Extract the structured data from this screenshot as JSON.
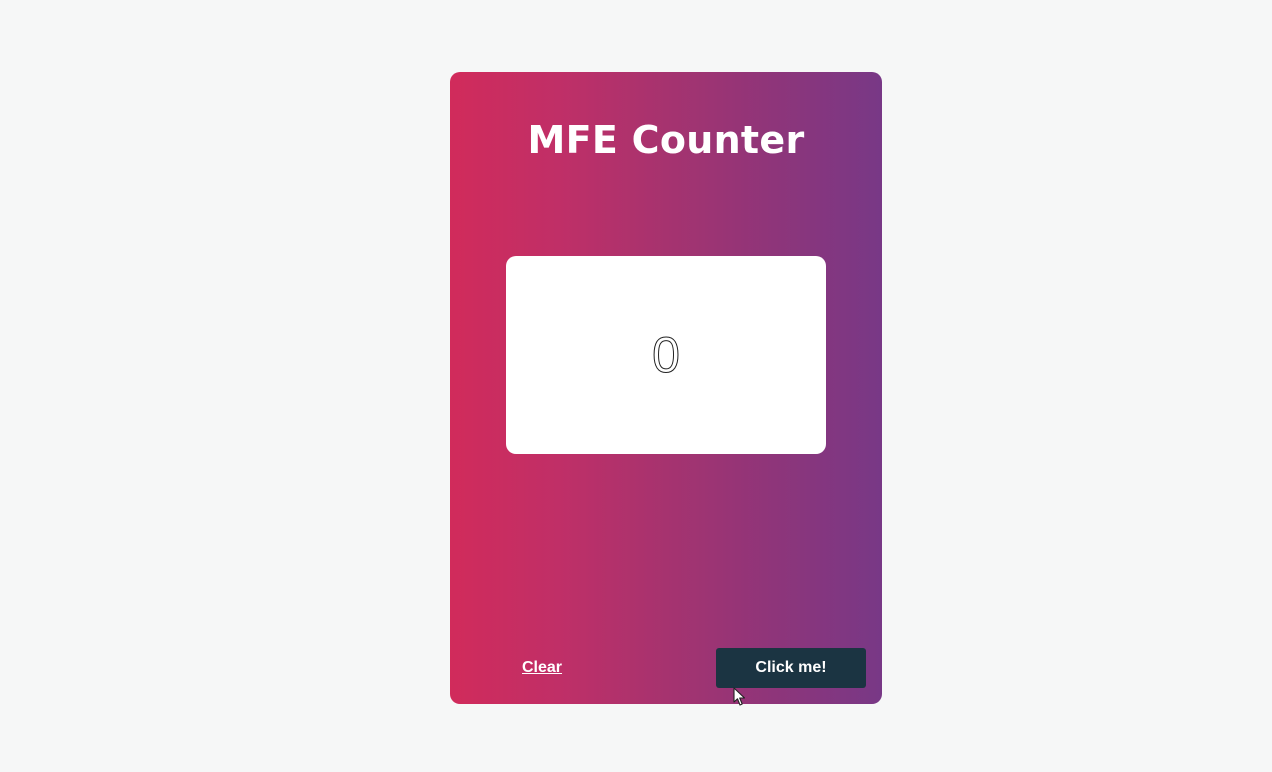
{
  "app": {
    "title": "MFE Counter"
  },
  "counter": {
    "value": "0"
  },
  "actions": {
    "clear_label": "Clear",
    "click_label": "Click me!"
  },
  "colors": {
    "page_background": "#f6f7f7",
    "gradient_start": "#d12b5b",
    "gradient_end": "#783886",
    "button_background": "#1b3442",
    "text_light": "#ffffff"
  },
  "icons": {
    "cursor": "mouse-pointer-icon"
  }
}
